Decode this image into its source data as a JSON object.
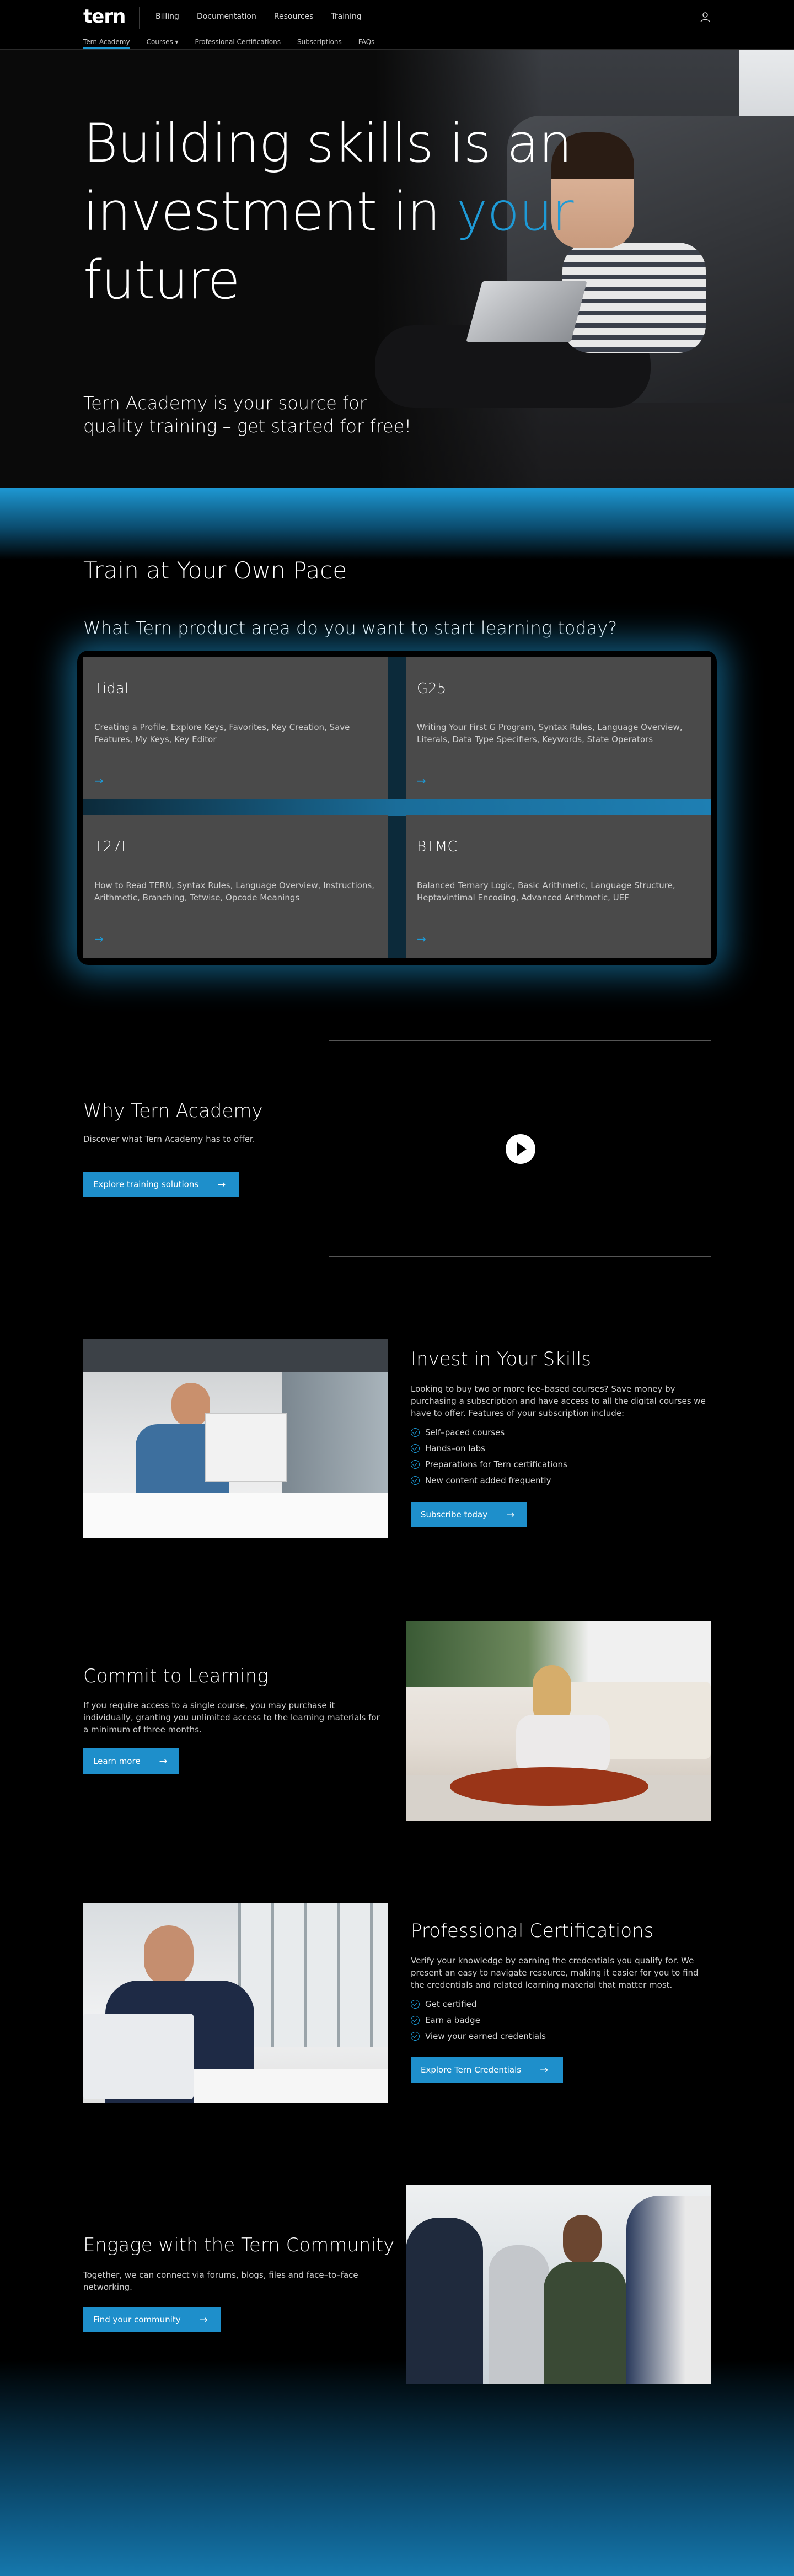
{
  "nav": {
    "logo": "tern",
    "links": [
      "Billing",
      "Documentation",
      "Resources",
      "Training"
    ],
    "sub_links": [
      "Tern Academy",
      "Courses ▾",
      "Professional Certifications",
      "Subscriptions",
      "FAQs"
    ]
  },
  "hero": {
    "title_line1": "Building skills is an",
    "title_line2a": "investment in ",
    "title_line2b": "your",
    "title_line3": "future",
    "subtitle": "Tern Academy is your source for quality training – get started for free!"
  },
  "train": {
    "title": "Train at Your Own Pace",
    "question": "What Tern product area do you want to start learning today?",
    "cards": [
      {
        "title": "Tidal",
        "text": "Creating a Profile, Explore Keys, Favorites, Key Creation, Save Features, My Keys, Key Editor",
        "arrow": "→"
      },
      {
        "title": "G25",
        "text": "Writing Your First G Program, Syntax Rules, Language Overview, Literals, Data Type Specifiers, Keywords, State Operators",
        "arrow": "→"
      },
      {
        "title": "T27I",
        "text": "How to Read TERN, Syntax Rules, Language Overview, Instructions, Arithmetic, Branching, Tetwise, Opcode Meanings",
        "arrow": "→"
      },
      {
        "title": "BTMC",
        "text": "Balanced Ternary Logic, Basic Arithmetic, Language Structure, Heptavintimal Encoding, Advanced Arithmetic, UEF",
        "arrow": "→"
      }
    ]
  },
  "why": {
    "title": "Why Tern Academy",
    "text": "Discover what Tern Academy has to offer.",
    "button": "Explore training solutions"
  },
  "invest": {
    "title": "Invest in Your Skills",
    "text": "Looking to buy two or more fee–based courses? Save money by purchasing a subscription and have access to all the digital courses we have to offer. Features of your subscription include:",
    "items": [
      "Self–paced courses",
      "Hands–on labs",
      "Preparations for Tern certifications",
      "New content added frequently"
    ],
    "button": "Subscribe today"
  },
  "commit": {
    "title": "Commit to Learning",
    "text": "If you require access to a single course, you may purchase it individually, granting you unlimited access to the learning materials for a minimum of three months.",
    "button": "Learn more"
  },
  "certs": {
    "title": "Professional Certifications",
    "text": "Verify your knowledge by earning the credentials you qualify for. We present an easy to navigate resource, making it easier for you to find the credentials and related learning material that matter most.",
    "items": [
      "Get certified",
      "Earn a badge",
      "View your earned credentials"
    ],
    "button": "Explore Tern Credentials"
  },
  "community": {
    "title": "Engage with the Tern Community",
    "text": "Together, we can connect via forums, blogs, files and face–to–face networking.",
    "button": "Find your community"
  },
  "arrow": "→",
  "colors": {
    "accent": "#1e8fcb",
    "background": "#000000",
    "card": "#4a4a4a"
  }
}
